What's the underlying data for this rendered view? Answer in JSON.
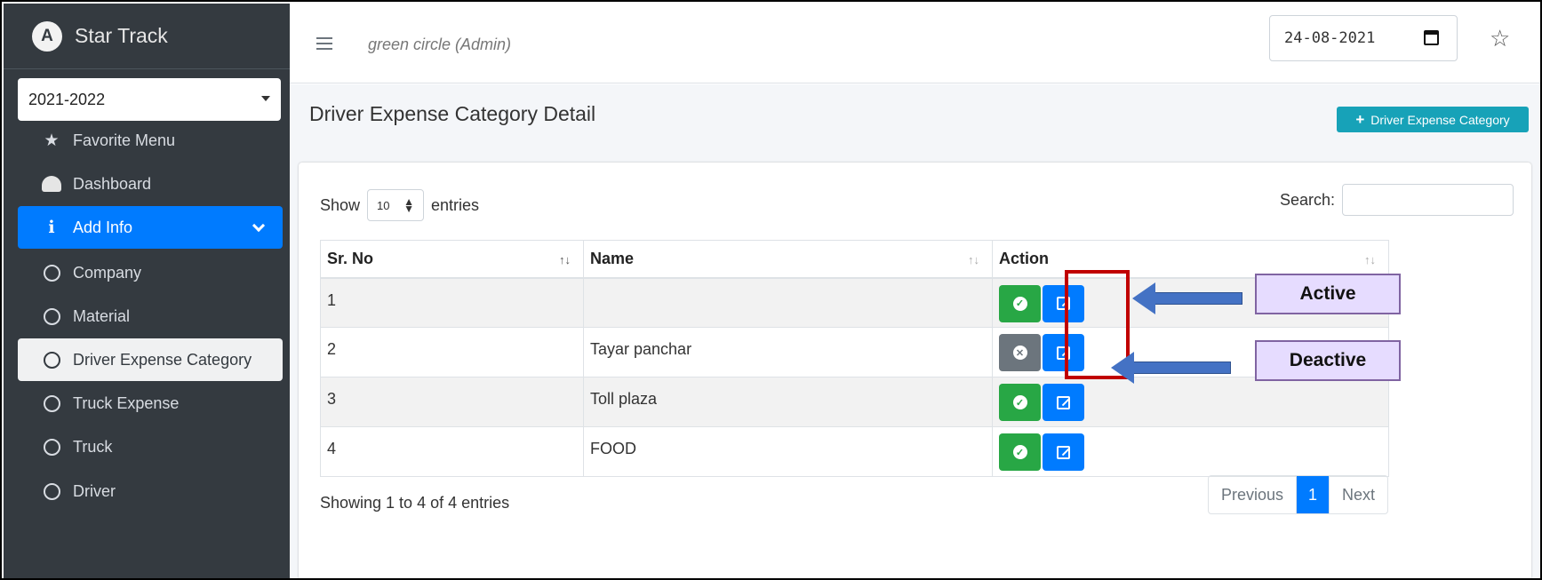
{
  "sidebar": {
    "brand_logo": "A",
    "brand_name": "Star Track",
    "year_select": "2021-2022",
    "items": [
      {
        "label": "Favorite Menu",
        "icon": "star-icon"
      },
      {
        "label": "Dashboard",
        "icon": "dashboard-icon"
      },
      {
        "label": "Add Info",
        "icon": "info-icon"
      },
      {
        "label": "Company",
        "icon": "circle-icon"
      },
      {
        "label": "Material",
        "icon": "circle-icon"
      },
      {
        "label": "Driver Expense Category",
        "icon": "circle-icon"
      },
      {
        "label": "Truck Expense",
        "icon": "circle-icon"
      },
      {
        "label": "Truck",
        "icon": "circle-icon"
      },
      {
        "label": "Driver",
        "icon": "circle-icon"
      }
    ]
  },
  "topbar": {
    "user_label": "green circle (Admin)",
    "date_value": "24-08-2021"
  },
  "content": {
    "page_title": "Driver Expense Category Detail",
    "add_button_label": "Driver Expense Category",
    "show_label": "Show",
    "entries_per_page": "10",
    "entries_label": "entries",
    "search_label": "Search:",
    "table": {
      "headers": [
        "Sr. No",
        "Name",
        "Action"
      ],
      "rows": [
        {
          "sr": "1",
          "name": "",
          "status": "active"
        },
        {
          "sr": "2",
          "name": "Tayar panchar",
          "status": "inactive"
        },
        {
          "sr": "3",
          "name": "Toll plaza",
          "status": "active"
        },
        {
          "sr": "4",
          "name": "FOOD",
          "status": "active"
        }
      ]
    },
    "info_text": "Showing 1 to 4 of 4 entries",
    "pagination": {
      "previous": "Previous",
      "current": "1",
      "next": "Next"
    }
  },
  "annotations": {
    "active_label": "Active",
    "deactive_label": "Deactive"
  },
  "colors": {
    "sidebar_bg": "#343a40",
    "accent_blue": "#007bff",
    "success_green": "#28a745",
    "inactive_gray": "#6c757d",
    "info_teal": "#17a2b8",
    "highlight_red": "#c00000"
  }
}
